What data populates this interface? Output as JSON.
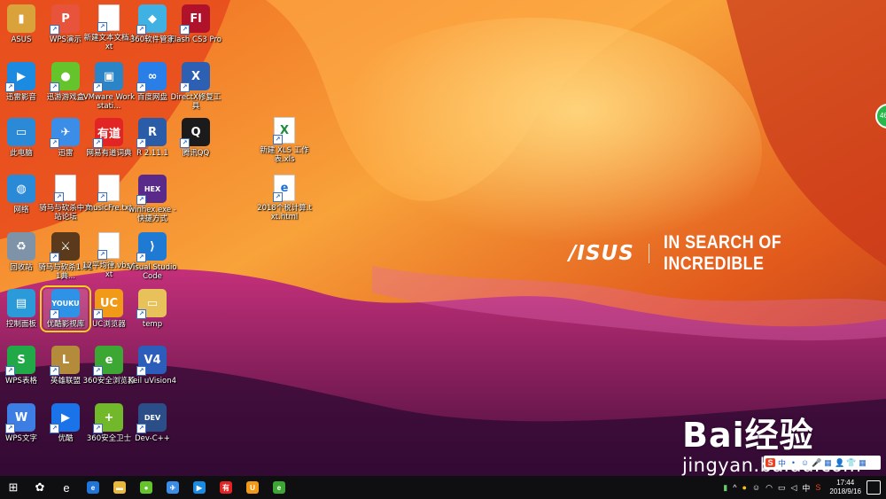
{
  "desktop": {
    "brand": {
      "logo": "/ISUS",
      "slogan": "IN SEARCH OF INCREDIBLE"
    },
    "icons": [
      {
        "label": "ASUS",
        "glyph": "▮",
        "bg": "#d9a23a"
      },
      {
        "label": "WPS演示",
        "glyph": "P",
        "bg": "#e8533c"
      },
      {
        "label": "新建文本文档.txt",
        "glyph": "",
        "bg": "#ffffff"
      },
      {
        "label": "360软件管家",
        "glyph": "◆",
        "bg": "#3fb1e3"
      },
      {
        "label": "Flash CS3 Pro",
        "glyph": "Fl",
        "bg": "#b0122c"
      },
      {
        "label": "迅雷影音",
        "glyph": "▶",
        "bg": "#1a8be0"
      },
      {
        "label": "迅游游戏盒",
        "glyph": "●",
        "bg": "#65c42c"
      },
      {
        "label": "VMware Workstati...",
        "glyph": "▣",
        "bg": "#2b84c6"
      },
      {
        "label": "百度网盘",
        "glyph": "∞",
        "bg": "#2a7ee8"
      },
      {
        "label": "DirectX修复工具",
        "glyph": "X",
        "bg": "#2d5fb3"
      },
      {
        "label": "此电脑",
        "glyph": "▭",
        "bg": "#2a8ad8"
      },
      {
        "label": "迅雷",
        "glyph": "✈",
        "bg": "#3b8de8"
      },
      {
        "label": "网易有道词典",
        "glyph": "有道",
        "bg": "#e32424"
      },
      {
        "label": "R 2.11.1",
        "glyph": "R",
        "bg": "#2b5ca8"
      },
      {
        "label": "腾讯QQ",
        "glyph": "Q",
        "bg": "#1b1b1b"
      },
      {
        "label": "网络",
        "glyph": "◍",
        "bg": "#2a8ad8"
      },
      {
        "label": "骑马与砍杀中文站论坛",
        "glyph": "",
        "bg": "#ffffff"
      },
      {
        "label": "musicFre.txt",
        "glyph": "",
        "bg": "#ffffff"
      },
      {
        "label": "winhex.exe - 快捷方式",
        "glyph": "HEX",
        "bg": "#5a2a8a"
      },
      {
        "label": "回收站",
        "glyph": "♻",
        "bg": "#7f93a8"
      },
      {
        "label": "骑马与砍杀1.011典...",
        "glyph": "⚔",
        "bg": "#5b3a1c"
      },
      {
        "label": "12平均律.vbs.txt",
        "glyph": "",
        "bg": "#ffffff"
      },
      {
        "label": "Visual Studio Code",
        "glyph": "⟩",
        "bg": "#1f7ad4"
      },
      {
        "label": "控制面板",
        "glyph": "▤",
        "bg": "#2a9ad8"
      },
      {
        "label": "优酷影视库",
        "glyph": "YOUKU",
        "bg": "#2e92e6"
      },
      {
        "label": "UC浏览器",
        "glyph": "UC",
        "bg": "#f09a18"
      },
      {
        "label": "temp",
        "glyph": "▭",
        "bg": "#e8c15a"
      },
      {
        "label": "WPS表格",
        "glyph": "S",
        "bg": "#20a946"
      },
      {
        "label": "英雄联盟",
        "glyph": "L",
        "bg": "#b38b3b"
      },
      {
        "label": "360安全浏览器",
        "glyph": "e",
        "bg": "#3ca833"
      },
      {
        "label": "Keil uVision4",
        "glyph": "V4",
        "bg": "#2c5dba"
      },
      {
        "label": "WPS文字",
        "glyph": "W",
        "bg": "#3d7ee4"
      },
      {
        "label": "优酷",
        "glyph": "▶",
        "bg": "#1a73e8"
      },
      {
        "label": "360安全卫士",
        "glyph": "+",
        "bg": "#71b82a"
      },
      {
        "label": "Dev-C++",
        "glyph": "DEV",
        "bg": "#2b4e88"
      },
      {
        "label": "新建 XLS 工作表.xls",
        "glyph": "X",
        "bg": "#ffffff"
      },
      {
        "label": "2018个税计算.txt.html",
        "glyph": "e",
        "bg": "#ffffff"
      }
    ],
    "selected_index": 24
  },
  "watermark": {
    "logo": "Bai经验",
    "url": "jingyan.baidu.com"
  },
  "sogou_toolbar": [
    "S",
    "中",
    "•",
    "☺",
    "🎤",
    "▦",
    "👤",
    "👕",
    "▦"
  ],
  "taskbar": {
    "items": [
      {
        "name": "start-button",
        "glyph": "⊞",
        "bg": ""
      },
      {
        "name": "fan-app",
        "glyph": "✿",
        "bg": ""
      },
      {
        "name": "ie-taskbar",
        "glyph": "e",
        "bg": ""
      },
      {
        "name": "edge-taskbar",
        "glyph": "e",
        "bg": "#1f75d8"
      },
      {
        "name": "explorer-taskbar",
        "glyph": "▬",
        "bg": "#e8b93c"
      },
      {
        "name": "game-box-taskbar",
        "glyph": "●",
        "bg": "#65c42c"
      },
      {
        "name": "xunlei-taskbar",
        "glyph": "✈",
        "bg": "#3b8de8"
      },
      {
        "name": "xunlei-player-taskbar",
        "glyph": "▶",
        "bg": "#1a8be0"
      },
      {
        "name": "youdao-taskbar",
        "glyph": "有",
        "bg": "#e32424"
      },
      {
        "name": "uc-taskbar",
        "glyph": "U",
        "bg": "#f09a18"
      },
      {
        "name": "360-browser-taskbar",
        "glyph": "e",
        "bg": "#3ca833"
      }
    ],
    "tray": {
      "ime": "中",
      "time": "17:44",
      "date": "2018/9/16"
    }
  }
}
